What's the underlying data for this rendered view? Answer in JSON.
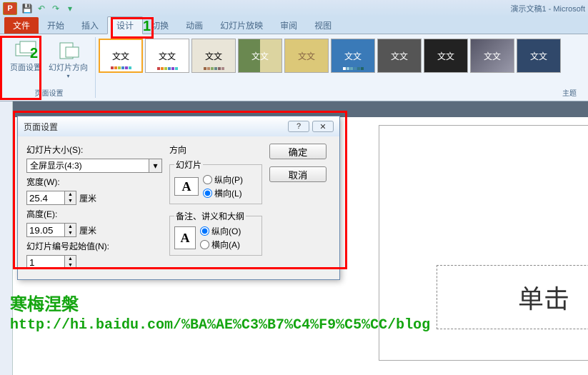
{
  "titlebar": {
    "app_icon_letter": "P",
    "doc_title": "演示文稿1 - Microsoft"
  },
  "tabs": {
    "file": "文件",
    "items": [
      "开始",
      "插入",
      "设计",
      "切换",
      "动画",
      "幻灯片放映",
      "审阅",
      "视图"
    ],
    "active_index": 2
  },
  "ribbon": {
    "page_setup": {
      "label": "页面设置",
      "btn_page_setup": "页面设置",
      "btn_orientation": "幻灯片方向"
    },
    "theme_text": "文文",
    "themes_group": "主题"
  },
  "dialog": {
    "title": "页面设置",
    "help": "?",
    "close": "✕",
    "left": {
      "size_label": "幻灯片大小(S):",
      "size_value": "全屏显示(4:3)",
      "width_label": "宽度(W):",
      "width_value": "25.4",
      "height_label": "高度(E):",
      "height_value": "19.05",
      "unit": "厘米",
      "start_label": "幻灯片编号起始值(N):",
      "start_value": "1"
    },
    "mid": {
      "dir": "方向",
      "slides": "幻灯片",
      "notes": "备注、讲义和大纲",
      "portrait_p": "纵向(P)",
      "landscape_l": "横向(L)",
      "portrait_o": "纵向(O)",
      "landscape_a": "横向(A)",
      "A": "A"
    },
    "buttons": {
      "ok": "确定",
      "cancel": "取消"
    }
  },
  "annotations": {
    "one": "1",
    "two": "2"
  },
  "watermark": {
    "name": "寒梅涅槃",
    "url": "http://hi.baidu.com/%BA%AE%C3%B7%C4%F9%C5%CC/blog"
  },
  "slide": {
    "placeholder": "单击"
  }
}
